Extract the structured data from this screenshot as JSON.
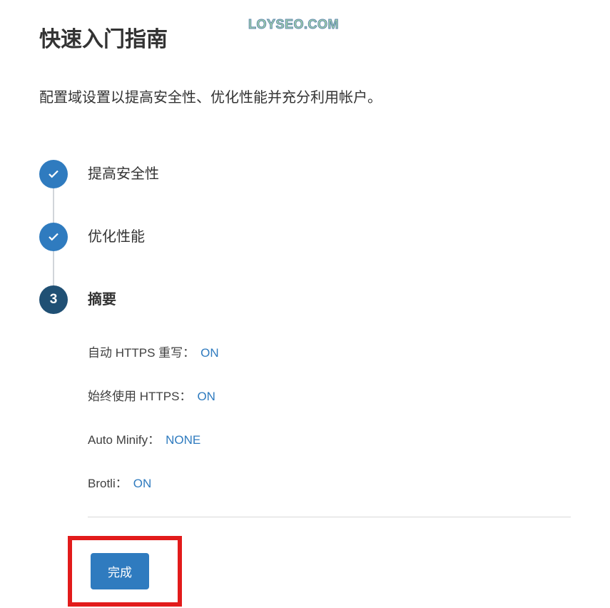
{
  "watermark": "LOYSEO.COM",
  "title": "快速入门指南",
  "subtitle": "配置域设置以提高安全性、优化性能并充分利用帐户。",
  "steps": [
    {
      "label": "提高安全性",
      "state": "done"
    },
    {
      "label": "优化性能",
      "state": "done"
    },
    {
      "label": "摘要",
      "state": "active",
      "number": "3"
    }
  ],
  "summary": [
    {
      "key": "自动 HTTPS 重写：",
      "value": "ON"
    },
    {
      "key": "始终使用 HTTPS：",
      "value": "ON"
    },
    {
      "key": "Auto Minify：",
      "value": "NONE"
    },
    {
      "key": "Brotli：",
      "value": "ON"
    }
  ],
  "finish_label": "完成"
}
